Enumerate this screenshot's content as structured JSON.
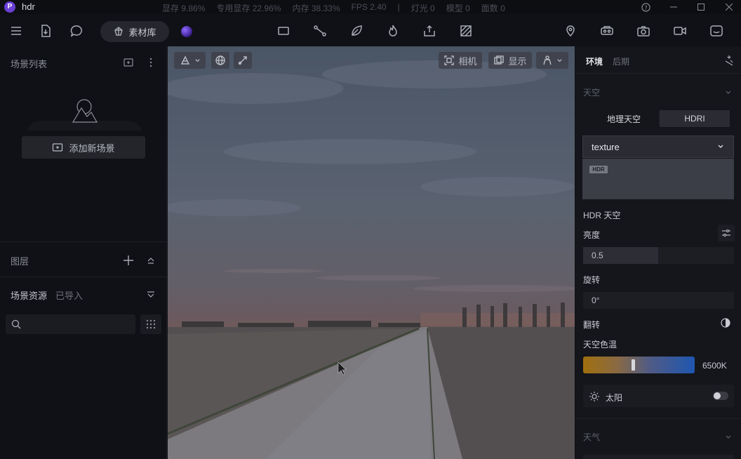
{
  "app": {
    "title": "hdr",
    "logo_letter": "P"
  },
  "stats": [
    {
      "label": "显存",
      "value": "9.86%"
    },
    {
      "label": "专用显存",
      "value": "22.96%"
    },
    {
      "label": "内存",
      "value": "38.33%"
    },
    {
      "label": "FPS",
      "value": "2.40"
    },
    {
      "label": "|",
      "value": ""
    },
    {
      "label": "灯光",
      "value": "0"
    },
    {
      "label": "模型",
      "value": "0"
    },
    {
      "label": "面数",
      "value": "0"
    }
  ],
  "toolbar": {
    "asset_library": "素材库"
  },
  "left": {
    "scene_list": "场景列表",
    "add_scene": "添加新场景",
    "layers": "图层",
    "scene_assets": "场景资源",
    "imported": "已导入",
    "search_placeholder": ""
  },
  "viewport": {
    "camera": "相机",
    "display": "显示"
  },
  "right": {
    "tabs": [
      "环境",
      "后期"
    ],
    "sky_section": "天空",
    "sky_modes": [
      "地理天空",
      "HDRI"
    ],
    "texture_select": "texture",
    "hdr_badge": "HDR",
    "hdr_sky": "HDR 天空",
    "brightness_label": "亮度",
    "brightness_value": "0.5",
    "brightness_fraction": 0.5,
    "rotation_label": "旋转",
    "rotation_value": "0°",
    "flip_label": "翻转",
    "sky_temp_label": "天空色温",
    "sky_temp_value": "6500K",
    "sun_label": "太阳",
    "sun_enabled": false,
    "weather_section": "天气"
  },
  "colors": {
    "accent": "#6a3fd4",
    "panel": "#15161b",
    "bg": "#101116"
  }
}
